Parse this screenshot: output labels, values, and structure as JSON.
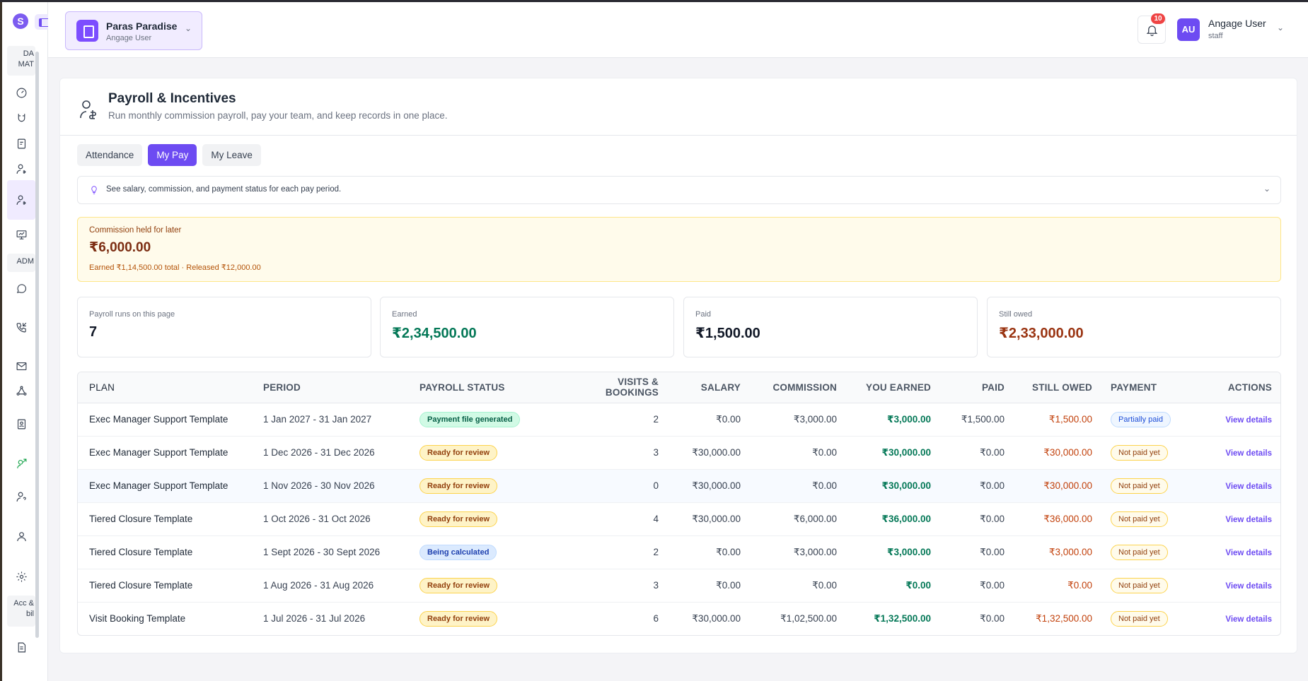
{
  "app": {
    "logo_letter": "S"
  },
  "sidebar": {
    "sections": {
      "dashboard": "DA MAT",
      "admin": "ADM",
      "account": "Acc & bil"
    }
  },
  "header": {
    "org": {
      "name": "Paras Paradise",
      "sub": "Angage User"
    },
    "notifications": {
      "count": "10"
    },
    "user": {
      "initials": "AU",
      "name": "Angage User",
      "role": "staff"
    }
  },
  "page": {
    "title": "Payroll & Incentives",
    "subtitle": "Run monthly commission payroll, pay your team, and keep records in one place.",
    "tabs": [
      {
        "label": "Attendance"
      },
      {
        "label": "My Pay"
      },
      {
        "label": "My Leave"
      }
    ],
    "hint": "See salary, commission, and payment status for each pay period."
  },
  "held": {
    "label": "Commission held for later",
    "value": "₹6,000.00",
    "note": "Earned ₹1,14,500.00 total · Released ₹12,000.00"
  },
  "stats": [
    {
      "label": "Payroll runs on this page",
      "value": "7"
    },
    {
      "label": "Earned",
      "value": "₹2,34,500.00"
    },
    {
      "label": "Paid",
      "value": "₹1,500.00"
    },
    {
      "label": "Still owed",
      "value": "₹2,33,000.00"
    }
  ],
  "table": {
    "headers": [
      "Plan",
      "Period",
      "Payroll status",
      "Visits & bookings",
      "Salary",
      "Commission",
      "You earned",
      "Paid",
      "Still owed",
      "Payment",
      "Actions"
    ],
    "rows": [
      {
        "plan": "Exec Manager Support Template",
        "period": "1 Jan 2027 - 31 Jan 2027",
        "status": "Payment file generated",
        "visits": "2",
        "salary": "₹0.00",
        "commission": "₹3,000.00",
        "earned": "₹3,000.00",
        "paid": "₹1,500.00",
        "owed": "₹1,500.00",
        "payment": "Partially paid",
        "action": "View details"
      },
      {
        "plan": "Exec Manager Support Template",
        "period": "1 Dec 2026 - 31 Dec 2026",
        "status": "Ready for review",
        "visits": "3",
        "salary": "₹30,000.00",
        "commission": "₹0.00",
        "earned": "₹30,000.00",
        "paid": "₹0.00",
        "owed": "₹30,000.00",
        "payment": "Not paid yet",
        "action": "View details"
      },
      {
        "plan": "Exec Manager Support Template",
        "period": "1 Nov 2026 - 30 Nov 2026",
        "status": "Ready for review",
        "visits": "0",
        "salary": "₹30,000.00",
        "commission": "₹0.00",
        "earned": "₹30,000.00",
        "paid": "₹0.00",
        "owed": "₹30,000.00",
        "payment": "Not paid yet",
        "action": "View details"
      },
      {
        "plan": "Tiered Closure Template",
        "period": "1 Oct 2026 - 31 Oct 2026",
        "status": "Ready for review",
        "visits": "4",
        "salary": "₹30,000.00",
        "commission": "₹6,000.00",
        "earned": "₹36,000.00",
        "paid": "₹0.00",
        "owed": "₹36,000.00",
        "payment": "Not paid yet",
        "action": "View details"
      },
      {
        "plan": "Tiered Closure Template",
        "period": "1 Sept 2026 - 30 Sept 2026",
        "status": "Being calculated",
        "visits": "2",
        "salary": "₹0.00",
        "commission": "₹3,000.00",
        "earned": "₹3,000.00",
        "paid": "₹0.00",
        "owed": "₹3,000.00",
        "payment": "Not paid yet",
        "action": "View details"
      },
      {
        "plan": "Tiered Closure Template",
        "period": "1 Aug 2026 - 31 Aug 2026",
        "status": "Ready for review",
        "visits": "3",
        "salary": "₹0.00",
        "commission": "₹0.00",
        "earned": "₹0.00",
        "paid": "₹0.00",
        "owed": "₹0.00",
        "payment": "Not paid yet",
        "action": "View details"
      },
      {
        "plan": "Visit Booking Template",
        "period": "1 Jul 2026 - 31 Jul 2026",
        "status": "Ready for review",
        "visits": "6",
        "salary": "₹30,000.00",
        "commission": "₹1,02,500.00",
        "earned": "₹1,32,500.00",
        "paid": "₹0.00",
        "owed": "₹1,32,500.00",
        "payment": "Not paid yet",
        "action": "View details"
      }
    ]
  }
}
